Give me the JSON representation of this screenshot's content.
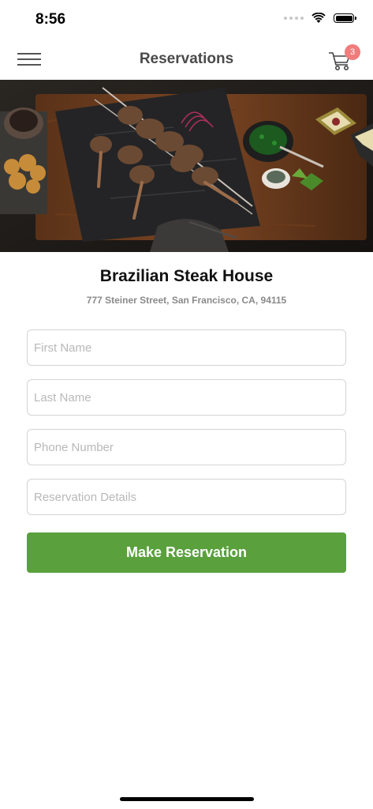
{
  "status_bar": {
    "time": "8:56"
  },
  "nav": {
    "title": "Reservations",
    "cart_count": "3"
  },
  "restaurant": {
    "name": "Brazilian Steak House",
    "address": "777 Steiner Street, San Francisco, CA, 94115"
  },
  "form": {
    "first_name_placeholder": "First Name",
    "last_name_placeholder": "Last Name",
    "phone_placeholder": "Phone Number",
    "details_placeholder": "Reservation Details",
    "submit_label": "Make Reservation"
  },
  "colors": {
    "accent": "#5aa03d",
    "badge": "#f07c7c"
  }
}
